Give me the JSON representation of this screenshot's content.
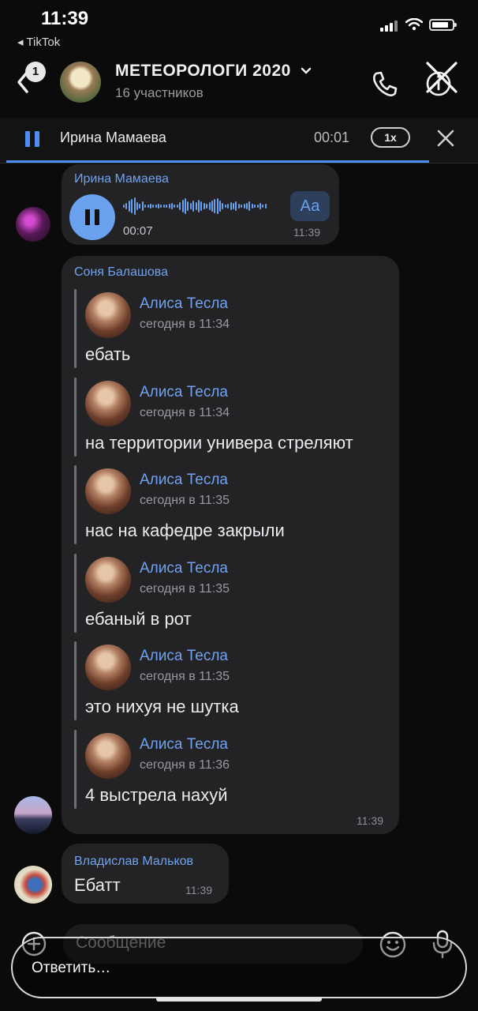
{
  "status_bar": {
    "time": "11:39",
    "back_app": "◂ TikTok"
  },
  "header": {
    "back_badge": "1",
    "title": "МЕТЕОРОЛОГИ 2020",
    "subtitle": "16 участников"
  },
  "player": {
    "name": "Ирина Мамаева",
    "time": "00:01",
    "speed": "1x"
  },
  "messages": {
    "voice": {
      "sender": "Ирина Мамаева",
      "duration": "00:07",
      "time": "11:39",
      "transcribe_label": "Аа"
    },
    "forwarded": {
      "sender": "Соня Балашова",
      "time": "11:39",
      "items": [
        {
          "name": "Алиса Тесла",
          "date": "сегодня в 11:34",
          "text": "ебать"
        },
        {
          "name": "Алиса Тесла",
          "date": "сегодня в 11:34",
          "text": "на территории универа стреляют"
        },
        {
          "name": "Алиса Тесла",
          "date": "сегодня в 11:35",
          "text": "нас на кафедре закрыли"
        },
        {
          "name": "Алиса Тесла",
          "date": "сегодня в 11:35",
          "text": "ебаный в рот"
        },
        {
          "name": "Алиса Тесла",
          "date": "сегодня в 11:35",
          "text": "это нихуя не шутка"
        },
        {
          "name": "Алиса Тесла",
          "date": "сегодня в 11:36",
          "text": "4 выстрела нахуй"
        }
      ]
    },
    "vlad": {
      "sender": "Владислав Мальков",
      "text": "Ебатт",
      "time": "11:39"
    }
  },
  "composer": {
    "placeholder": "Сообщение",
    "reply_label": "Ответить…"
  },
  "colors": {
    "accent": "#4e8cf0",
    "sender": "#70a3ef",
    "bubble": "#232326",
    "background": "#0b0b0c"
  }
}
